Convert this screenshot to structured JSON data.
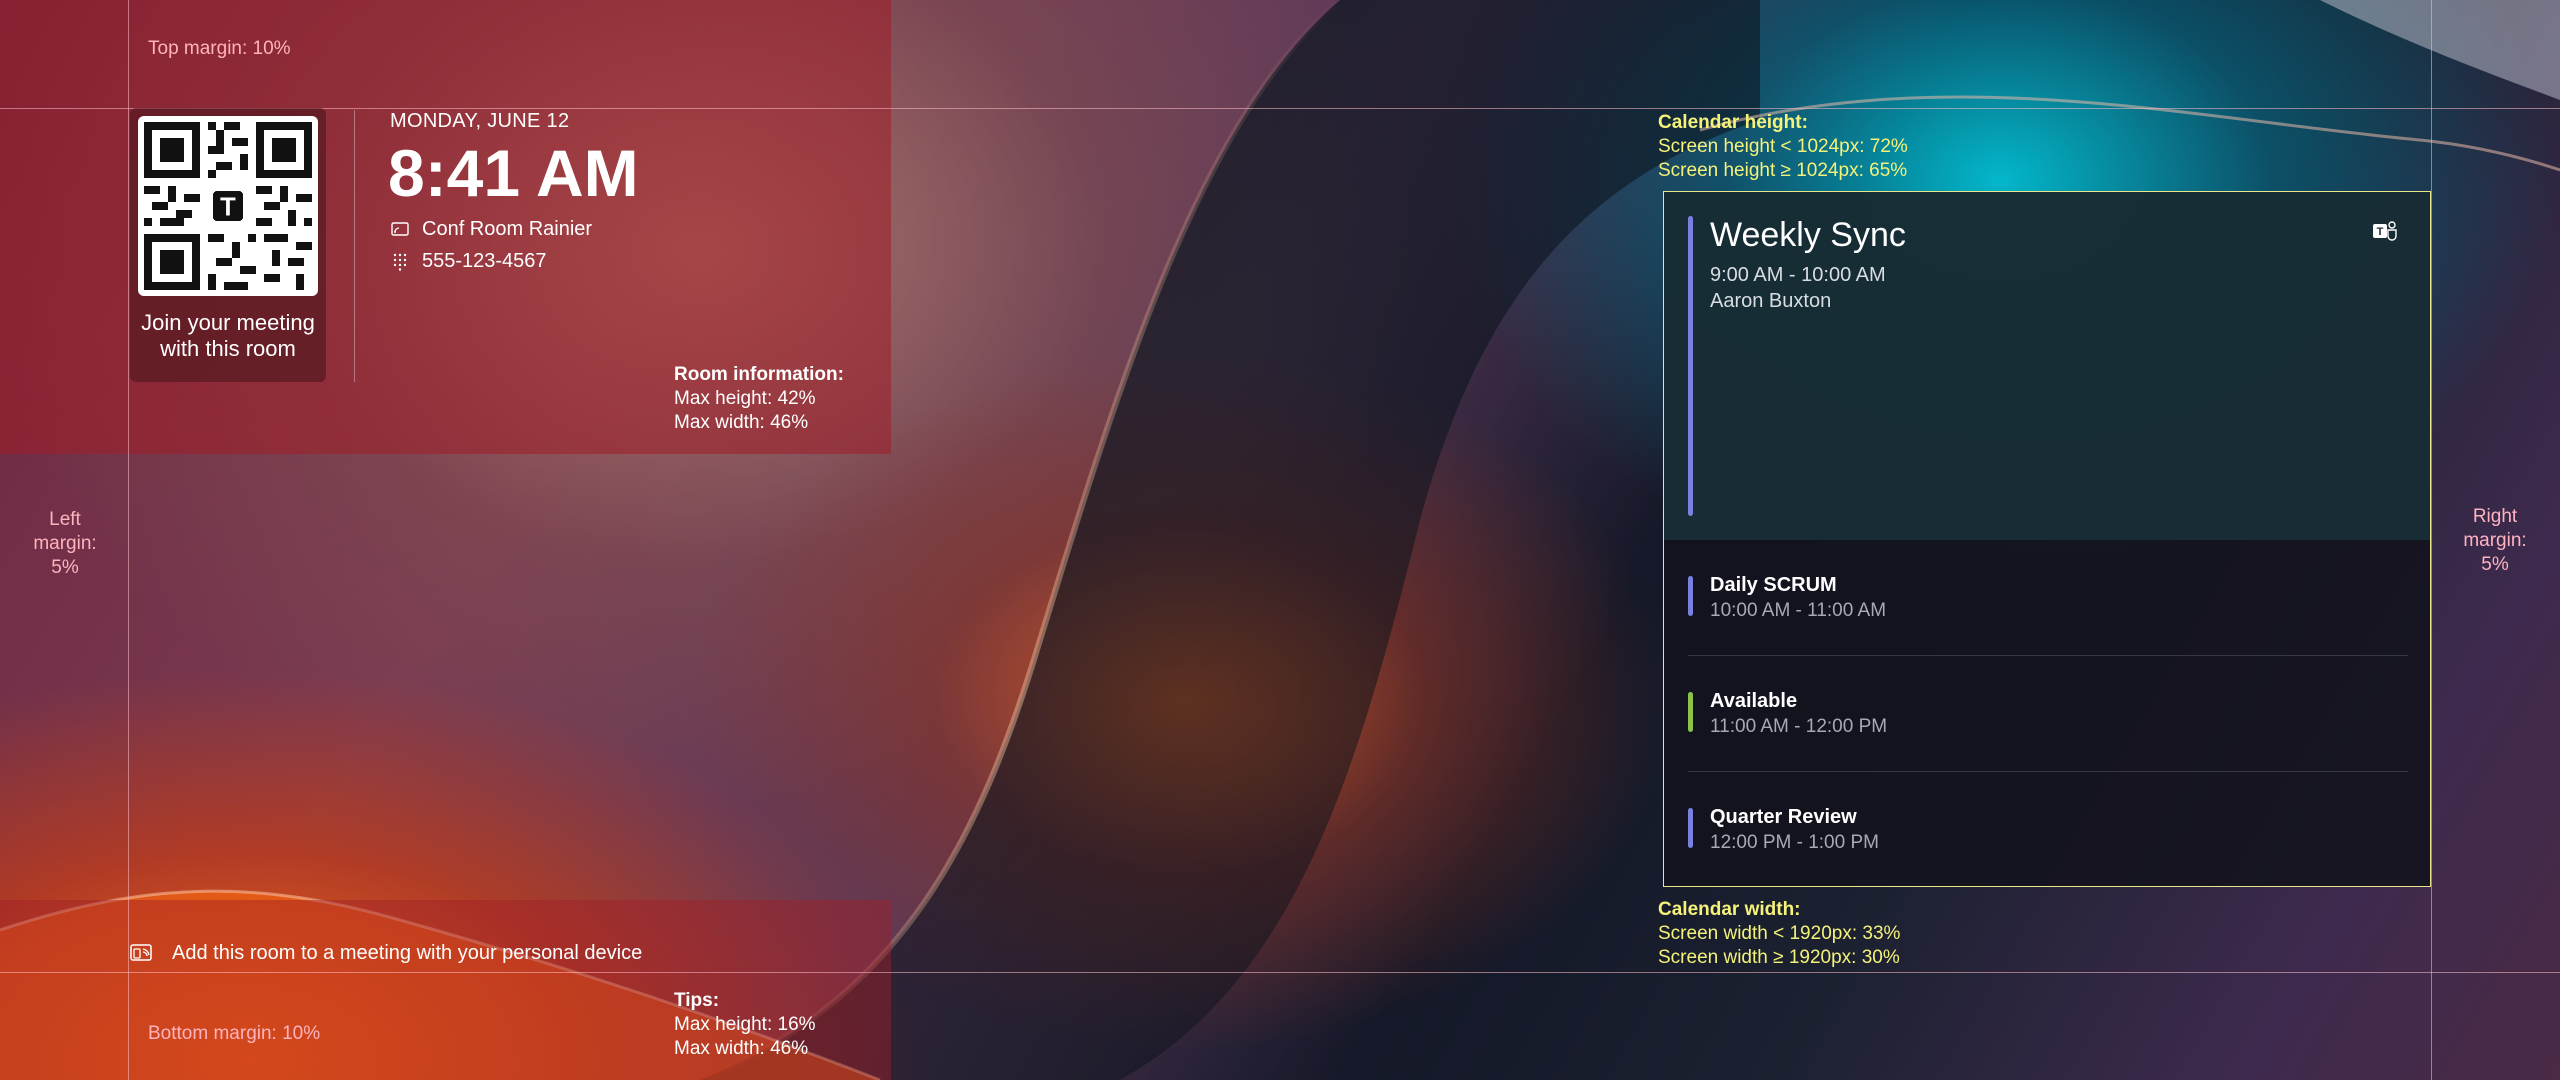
{
  "room": {
    "date": "MONDAY, JUNE 12",
    "time": "8:41 AM",
    "name": "Conf Room Rainier",
    "phone": "555-123-4567",
    "qr_caption": "Join your meeting with this room"
  },
  "calendar": {
    "current": {
      "title": "Weekly Sync",
      "time": "9:00 AM - 10:00 AM",
      "organizer": "Aaron Buxton",
      "accent": "#7a80e0"
    },
    "upcoming": [
      {
        "name": "Daily SCRUM",
        "time": "10:00 AM - 11:00 AM",
        "accent": "#7a80e0"
      },
      {
        "name": "Available",
        "time": "11:00 AM - 12:00 PM",
        "accent": "#8bc34a"
      },
      {
        "name": "Quarter Review",
        "time": "12:00 PM - 1:00 PM",
        "accent": "#7a80e0"
      }
    ]
  },
  "tip": {
    "text": "Add this room to a meeting with your personal device",
    "icon": "cast-device-icon"
  },
  "annotations": {
    "top_margin": "Top margin: 10%",
    "bottom_margin": "Bottom margin: 10%",
    "left_margin": [
      "Left",
      "margin:",
      "5%"
    ],
    "right_margin": [
      "Right",
      "margin:",
      "5%"
    ],
    "room_info": {
      "title": "Room information:",
      "lines": [
        "Max height: 42%",
        "Max width: 46%"
      ]
    },
    "tips": {
      "title": "Tips:",
      "lines": [
        "Max height: 16%",
        "Max width: 46%"
      ]
    },
    "calendar_height": {
      "title": "Calendar height:",
      "lines": [
        "Screen height < 1024px: 72%",
        "Screen height ≥ 1024px: 65%"
      ]
    },
    "calendar_width": {
      "title": "Calendar width:",
      "lines": [
        "Screen width < 1920px: 33%",
        "Screen width ≥ 1920px: 30%"
      ]
    }
  },
  "colors": {
    "zone_overlay": "#a01e28",
    "guide_line": "#ffbec8",
    "calendar_border": "#e9e78a",
    "annotation_yellow": "#f5f27a",
    "annotation_pink": "#ffb3bf"
  }
}
